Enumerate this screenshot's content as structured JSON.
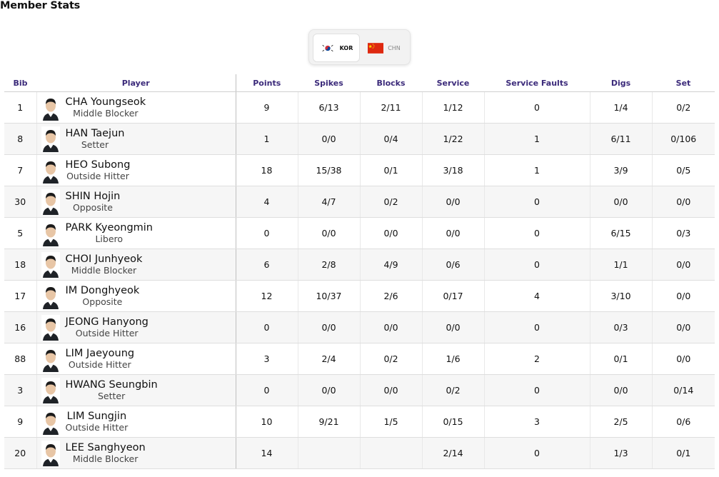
{
  "page_title": "Member Stats",
  "team_switcher": {
    "teams": [
      {
        "code": "KOR",
        "active": true
      },
      {
        "code": "CHN",
        "active": false
      }
    ]
  },
  "table": {
    "headers": [
      "Bib",
      "Player",
      "Points",
      "Spikes",
      "Blocks",
      "Service",
      "Service Faults",
      "Digs",
      "Set"
    ],
    "rows": [
      {
        "bib": "1",
        "name": "CHA Youngseok",
        "position": "Middle Blocker",
        "points": "9",
        "spikes": "6/13",
        "blocks": "2/11",
        "service": "1/12",
        "service_faults": "0",
        "digs": "1/4",
        "set": "0/2"
      },
      {
        "bib": "8",
        "name": "HAN Taejun",
        "position": "Setter",
        "points": "1",
        "spikes": "0/0",
        "blocks": "0/4",
        "service": "1/22",
        "service_faults": "1",
        "digs": "6/11",
        "set": "0/106"
      },
      {
        "bib": "7",
        "name": "HEO Subong",
        "position": "Outside Hitter",
        "points": "18",
        "spikes": "15/38",
        "blocks": "0/1",
        "service": "3/18",
        "service_faults": "1",
        "digs": "3/9",
        "set": "0/5"
      },
      {
        "bib": "30",
        "name": "SHIN Hojin",
        "position": "Opposite",
        "points": "4",
        "spikes": "4/7",
        "blocks": "0/2",
        "service": "0/0",
        "service_faults": "0",
        "digs": "0/0",
        "set": "0/0"
      },
      {
        "bib": "5",
        "name": "PARK Kyeongmin",
        "position": "Libero",
        "points": "0",
        "spikes": "0/0",
        "blocks": "0/0",
        "service": "0/0",
        "service_faults": "0",
        "digs": "6/15",
        "set": "0/3"
      },
      {
        "bib": "18",
        "name": "CHOI Junhyeok",
        "position": "Middle Blocker",
        "points": "6",
        "spikes": "2/8",
        "blocks": "4/9",
        "service": "0/6",
        "service_faults": "0",
        "digs": "1/1",
        "set": "0/0"
      },
      {
        "bib": "17",
        "name": "IM Donghyeok",
        "position": "Opposite",
        "points": "12",
        "spikes": "10/37",
        "blocks": "2/6",
        "service": "0/17",
        "service_faults": "4",
        "digs": "3/10",
        "set": "0/0"
      },
      {
        "bib": "16",
        "name": "JEONG Hanyong",
        "position": "Outside Hitter",
        "points": "0",
        "spikes": "0/0",
        "blocks": "0/0",
        "service": "0/0",
        "service_faults": "0",
        "digs": "0/3",
        "set": "0/0"
      },
      {
        "bib": "88",
        "name": "LIM Jaeyoung",
        "position": "Outside Hitter",
        "points": "3",
        "spikes": "2/4",
        "blocks": "0/2",
        "service": "1/6",
        "service_faults": "2",
        "digs": "0/1",
        "set": "0/0"
      },
      {
        "bib": "3",
        "name": "HWANG Seungbin",
        "position": "Setter",
        "points": "0",
        "spikes": "0/0",
        "blocks": "0/0",
        "service": "0/2",
        "service_faults": "0",
        "digs": "0/0",
        "set": "0/14"
      },
      {
        "bib": "9",
        "name": "LIM Sungjin",
        "position": "Outside Hitter",
        "points": "10",
        "spikes": "9/21",
        "blocks": "1/5",
        "service": "0/15",
        "service_faults": "3",
        "digs": "2/5",
        "set": "0/6"
      },
      {
        "bib": "20",
        "name": "LEE Sanghyeon",
        "position": "Middle Blocker",
        "points": "14",
        "spikes": "",
        "blocks": "",
        "service": "2/14",
        "service_faults": "0",
        "digs": "1/3",
        "set": "0/1"
      }
    ]
  },
  "colors": {
    "header_text": "#3b2a7a",
    "row_alt_bg": "#f6f6f6"
  }
}
